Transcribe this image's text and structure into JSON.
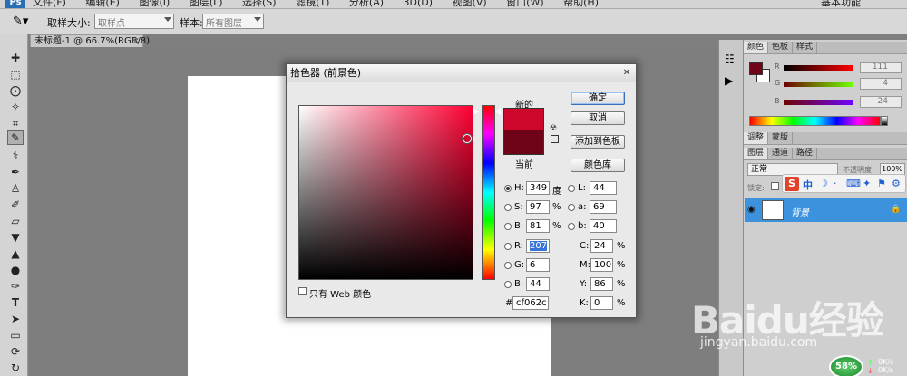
{
  "menubar": {
    "items": [
      "文件(F)",
      "编辑(E)",
      "图像(I)",
      "图层(L)",
      "选择(S)",
      "滤镜(T)",
      "分析(A)",
      "3D(D)",
      "视图(V)",
      "窗口(W)",
      "帮助(H)"
    ],
    "workspace": "基本功能"
  },
  "options": {
    "sample_size_label": "取样大小:",
    "sample_size_value": "取样点",
    "sample_label": "样本:",
    "sample_value": "所有图层"
  },
  "document": {
    "tab_title": "未标题-1 @ 66.7%(RGB/8)",
    "close_glyph": "×"
  },
  "color_panel": {
    "tabs": [
      "颜色",
      "色板",
      "样式"
    ],
    "channels": [
      {
        "label": "R",
        "value": "111",
        "gradient": "linear-gradient(to right, #000, #ff0000)"
      },
      {
        "label": "G",
        "value": "4",
        "gradient": "linear-gradient(to right, #6f0000, #6fff00)"
      },
      {
        "label": "B",
        "value": "24",
        "gradient": "linear-gradient(to right, #6f0400, #6f04ff)"
      }
    ]
  },
  "adjust_panel": {
    "tabs": [
      "调整",
      "蒙版"
    ]
  },
  "layers_panel": {
    "tabs": [
      "图层",
      "通道",
      "路径"
    ],
    "blend_mode": "正常",
    "opacity_label": "不透明度:",
    "opacity_value": "100%",
    "lock_label": "锁定:",
    "layer_name": "背景",
    "ime_items": [
      "中",
      "☽",
      "·",
      "⌨",
      "✦",
      "⚑",
      "⚙"
    ]
  },
  "dialog": {
    "title": "拾色器 (前景色)",
    "new_label": "新的",
    "current_label": "当前",
    "new_color": "#cf062c",
    "current_color": "#6f0418",
    "buttons": {
      "ok": "确定",
      "cancel": "取消",
      "add_swatch": "添加到色板",
      "color_library": "颜色库"
    },
    "hsb": [
      {
        "label": "H:",
        "value": "349",
        "unit": "度",
        "selected": true
      },
      {
        "label": "S:",
        "value": "97",
        "unit": "%",
        "selected": false
      },
      {
        "label": "B:",
        "value": "81",
        "unit": "%",
        "selected": false
      }
    ],
    "rgb": [
      {
        "label": "R:",
        "value": "207"
      },
      {
        "label": "G:",
        "value": "6"
      },
      {
        "label": "B:",
        "value": "44"
      }
    ],
    "lab": [
      {
        "label": "L:",
        "value": "44"
      },
      {
        "label": "a:",
        "value": "69"
      },
      {
        "label": "b:",
        "value": "40"
      }
    ],
    "cmyk": [
      {
        "label": "C:",
        "value": "24",
        "unit": "%"
      },
      {
        "label": "M:",
        "value": "100",
        "unit": "%"
      },
      {
        "label": "Y:",
        "value": "86",
        "unit": "%"
      },
      {
        "label": "K:",
        "value": "0",
        "unit": "%"
      }
    ],
    "hex_label": "#",
    "hex_value": "cf062c",
    "web_only_label": "只有 Web 颜色"
  },
  "watermark": {
    "text": "Baidu经验",
    "url": "jingyan.baidu.com"
  },
  "tray": {
    "percent": "58%",
    "up_rate": "0K/s",
    "down_rate": "0K/s"
  }
}
